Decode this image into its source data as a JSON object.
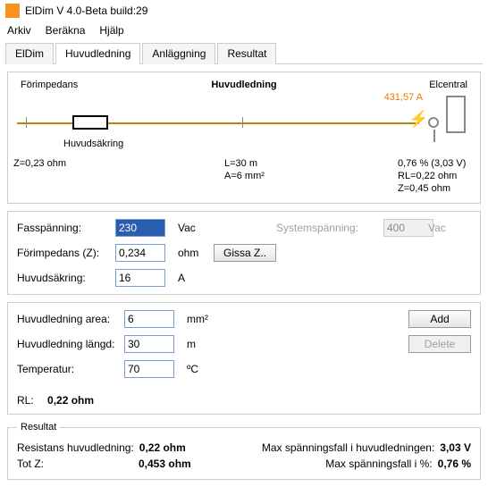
{
  "title": "ElDim V 4.0-Beta build:29",
  "menu": {
    "arkiv": "Arkiv",
    "berakna": "Beräkna",
    "hjalp": "Hjälp"
  },
  "tabs": {
    "eldim": "ElDim",
    "huvudledning": "Huvudledning",
    "anlaggning": "Anläggning",
    "resultat": "Resultat"
  },
  "diagram": {
    "forimpedans": "Förimpedans",
    "huvudledning": "Huvudledning",
    "elcentral": "Elcentral",
    "huvudsakring": "Huvudsäkring",
    "z_src": "Z=0,23 ohm",
    "len": "L=30 m",
    "area": "A=6 mm²",
    "current": "431,57 A",
    "drop": "0,76 % (3,03 V)",
    "rl": "RL=0,22 ohm",
    "z_end": "Z=0,45 ohm"
  },
  "form1": {
    "fassp_label": "Fasspänning:",
    "fassp_val": "230",
    "fassp_unit": "Vac",
    "forimp_label": "Förimpedans (Z):",
    "forimp_val": "0,234",
    "forimp_unit": "ohm",
    "gissa": "Gissa Z..",
    "sakr_label": "Huvudsäkring:",
    "sakr_val": "16",
    "sakr_unit": "A",
    "sys_label": "Systemspänning:",
    "sys_val": "400",
    "sys_unit": "Vac"
  },
  "form2": {
    "area_label": "Huvudledning area:",
    "area_val": "6",
    "area_unit": "mm²",
    "len_label": "Huvudledning längd:",
    "len_val": "30",
    "len_unit": "m",
    "temp_label": "Temperatur:",
    "temp_val": "70",
    "temp_unit": "ºC",
    "add": "Add",
    "delete": "Delete",
    "rl_label": "RL:",
    "rl_val": "0,22 ohm"
  },
  "result": {
    "legend": "Resultat",
    "res_label": "Resistans huvudledning:",
    "res_val": "0,22 ohm",
    "totz_label": "Tot Z:",
    "totz_val": "0,453 ohm",
    "maxdrop_label": "Max spänningsfall i huvudledningen:",
    "maxdrop_val": "3,03 V",
    "maxpct_label": "Max spänningsfall i %:",
    "maxpct_val": "0,76 %"
  }
}
